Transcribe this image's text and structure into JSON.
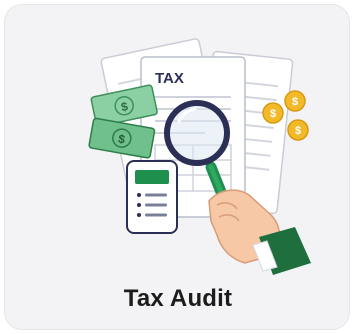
{
  "card": {
    "title": "Tax Audit",
    "illustration_icon": "tax-audit-illustration",
    "document_heading": "TAX",
    "dollar_symbol": "$"
  },
  "colors": {
    "card_background": "#f3f3f5",
    "title_text": "#1c1c1c",
    "money_green": "#6fc08a",
    "accent_green": "#1f8f4e",
    "coin_gold": "#f2b928",
    "lens_navy": "#2b2f55",
    "skin": "#f6c8a6"
  }
}
